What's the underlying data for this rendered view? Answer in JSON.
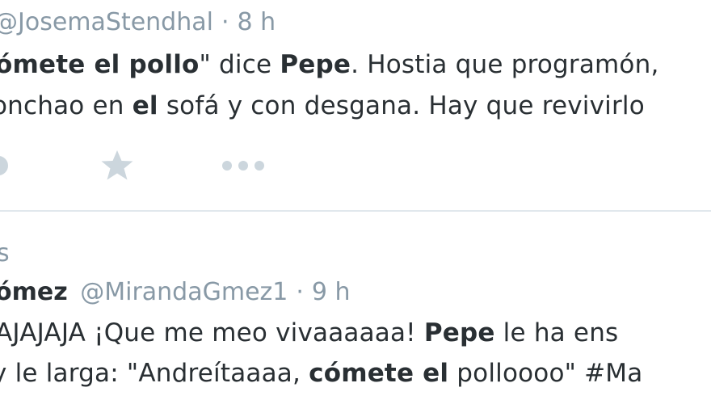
{
  "tweet1": {
    "handle": "@JosemaStendhal",
    "separator": "·",
    "time": "8 h",
    "line1": {
      "quote_bold": "ómete el pollo",
      "after_quote": "\" dice ",
      "pepe": "Pepe",
      "rest": ". Hostia que programón,"
    },
    "line2": {
      "start": "onchao en ",
      "el": "el",
      "rest": " sofá y con desgana. Hay que revivirlo"
    }
  },
  "actions": {
    "reply_icon": "reply-icon",
    "favorite_icon": "star-icon",
    "more_icon": "more-icon"
  },
  "tweet2": {
    "context_fragment": "s",
    "name": "ómez",
    "handle": "@MirandaGmez1",
    "separator": "·",
    "time": "9 h",
    "line1": {
      "start": "AJAJAJA ¡Que me meo vivaaaaaa! ",
      "pepe": "Pepe",
      "rest": " le ha ens"
    },
    "line2": {
      "start": " y le larga: \"Andreítaaaa, ",
      "bold": "cómete el",
      "rest": " polloooo\" ",
      "hashtag": "#Ma"
    }
  },
  "colors": {
    "text": "#292f33",
    "meta": "#8899a6",
    "icon": "#ccd6dd",
    "divider": "#e1e8ed"
  }
}
